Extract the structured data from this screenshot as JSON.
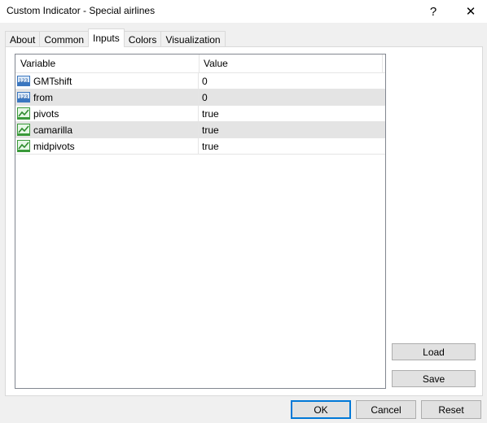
{
  "window": {
    "title": "Custom Indicator - Special airlines",
    "help_glyph": "?",
    "close_glyph": "✕"
  },
  "tabs": [
    {
      "label": "About",
      "active": false
    },
    {
      "label": "Common",
      "active": false
    },
    {
      "label": "Inputs",
      "active": true
    },
    {
      "label": "Colors",
      "active": false
    },
    {
      "label": "Visualization",
      "active": false
    }
  ],
  "inputs_table": {
    "columns": [
      "Variable",
      "Value"
    ],
    "rows": [
      {
        "icon": "numeric-icon",
        "variable": "GMTshift",
        "value": "0"
      },
      {
        "icon": "numeric-icon",
        "variable": "from",
        "value": "0"
      },
      {
        "icon": "boolean-icon",
        "variable": "pivots",
        "value": "true"
      },
      {
        "icon": "boolean-icon",
        "variable": "camarilla",
        "value": "true"
      },
      {
        "icon": "boolean-icon",
        "variable": "midpivots",
        "value": "true"
      }
    ]
  },
  "side_buttons": {
    "load_label": "Load",
    "save_label": "Save"
  },
  "footer_buttons": {
    "ok_label": "OK",
    "cancel_label": "Cancel",
    "reset_label": "Reset"
  },
  "colors": {
    "focus_border": "#0078d7",
    "selected_row": "#e4e4e4"
  }
}
